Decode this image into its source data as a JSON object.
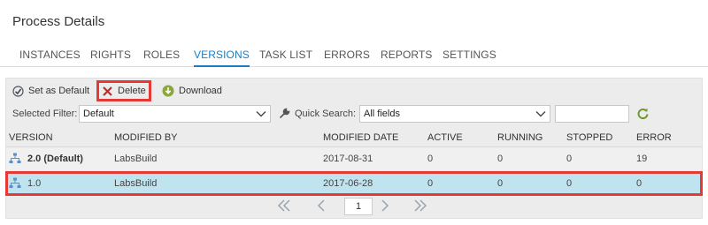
{
  "page": {
    "title": "Process Details"
  },
  "tabs": [
    {
      "label": "INSTANCES"
    },
    {
      "label": "RIGHTS"
    },
    {
      "label": "ROLES"
    },
    {
      "label": "VERSIONS",
      "active": true
    },
    {
      "label": "TASK LIST"
    },
    {
      "label": "ERRORS"
    },
    {
      "label": "REPORTS"
    },
    {
      "label": "SETTINGS"
    }
  ],
  "toolbar": {
    "set_default_label": "Set as Default",
    "delete_label": "Delete",
    "download_label": "Download",
    "icons": {
      "set_default": "checkmark-icon",
      "delete": "x-icon",
      "download": "download-icon"
    }
  },
  "filters": {
    "selected_filter_label": "Selected Filter:",
    "selected_filter_value": "Default",
    "quick_search_label": "Quick Search:",
    "quick_search_field": "All fields",
    "quick_search_text": "",
    "icons": {
      "quick_search": "wrench-icon",
      "refresh": "refresh-icon"
    }
  },
  "grid": {
    "columns": [
      "VERSION",
      "MODIFIED BY",
      "MODIFIED DATE",
      "ACTIVE",
      "RUNNING",
      "STOPPED",
      "ERROR"
    ],
    "rows": [
      {
        "version": "2.0 (Default)",
        "modified_by": "LabsBuild",
        "modified_date": "2017-08-31",
        "active": "0",
        "running": "0",
        "stopped": "0",
        "error": "19"
      },
      {
        "version": "1.0",
        "modified_by": "LabsBuild",
        "modified_date": "2017-06-28",
        "active": "0",
        "running": "0",
        "stopped": "0",
        "error": "0",
        "selected": true
      }
    ]
  },
  "pager": {
    "current_page": "1"
  },
  "colors": {
    "accent": "#1a7ec2",
    "highlight": "#e53935",
    "selected_row": "#bfe4f0"
  }
}
